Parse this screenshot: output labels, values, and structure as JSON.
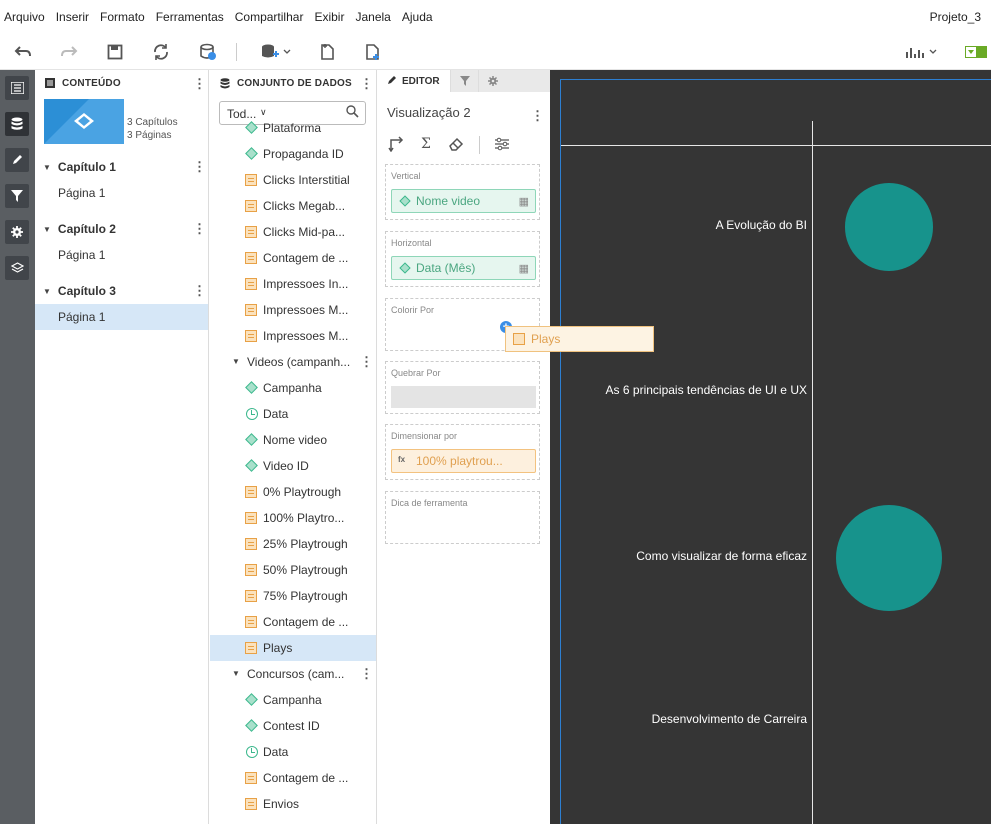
{
  "menu": {
    "items": [
      "Arquivo",
      "Inserir",
      "Formato",
      "Ferramentas",
      "Compartilhar",
      "Exibir",
      "Janela",
      "Ajuda"
    ],
    "project": "Projeto_3"
  },
  "toolbar": {
    "icons": [
      "undo-icon",
      "redo-icon",
      "save-icon",
      "refresh-icon",
      "datasource-icon",
      "add-data-icon",
      "duplicate-page-icon",
      "new-page-icon",
      "chart-type-icon",
      "layout-icon"
    ]
  },
  "content_panel": {
    "title": "CONTEÚDO",
    "chapters_count": "3 Capítulos",
    "pages_count": "3 Páginas",
    "chapters": [
      {
        "label": "Capítulo 1",
        "pages": [
          "Página 1"
        ]
      },
      {
        "label": "Capítulo 2",
        "pages": [
          "Página 1"
        ]
      },
      {
        "label": "Capítulo 3",
        "pages": [
          "Página 1"
        ]
      }
    ]
  },
  "dataset_panel": {
    "title": "CONJUNTO DE DADOS",
    "filter_value": "Tod...",
    "items": [
      {
        "type": "dim",
        "label": "Plataforma"
      },
      {
        "type": "dim",
        "label": "Propaganda ID"
      },
      {
        "type": "meas",
        "label": "Clicks Interstitial"
      },
      {
        "type": "meas",
        "label": "Clicks Megab..."
      },
      {
        "type": "meas",
        "label": "Clicks Mid-pa..."
      },
      {
        "type": "meas",
        "label": "Contagem de ..."
      },
      {
        "type": "meas",
        "label": "Impressoes In..."
      },
      {
        "type": "meas",
        "label": "Impressoes M..."
      },
      {
        "type": "meas",
        "label": "Impressoes M..."
      },
      {
        "type": "group",
        "label": "Videos (campanh..."
      },
      {
        "type": "dim",
        "label": "Campanha"
      },
      {
        "type": "time",
        "label": "Data"
      },
      {
        "type": "dim",
        "label": "Nome video"
      },
      {
        "type": "dim",
        "label": "Video ID"
      },
      {
        "type": "meas",
        "label": "0% Playtrough"
      },
      {
        "type": "meas",
        "label": "100% Playtro..."
      },
      {
        "type": "meas",
        "label": "25% Playtrough"
      },
      {
        "type": "meas",
        "label": "50% Playtrough"
      },
      {
        "type": "meas",
        "label": "75% Playtrough"
      },
      {
        "type": "meas",
        "label": "Contagem de ..."
      },
      {
        "type": "meas",
        "label": "Plays"
      },
      {
        "type": "group",
        "label": "Concursos (cam..."
      },
      {
        "type": "dim",
        "label": "Campanha"
      },
      {
        "type": "dim",
        "label": "Contest ID"
      },
      {
        "type": "time",
        "label": "Data"
      },
      {
        "type": "meas",
        "label": "Contagem de ..."
      },
      {
        "type": "meas",
        "label": "Envios"
      }
    ]
  },
  "editor": {
    "tab_label": "EDITOR",
    "viz_title": "Visualização 2",
    "shelves": {
      "vertical": {
        "label": "Vertical",
        "pill": "Nome video"
      },
      "horizontal": {
        "label": "Horizontal",
        "pill": "Data (Mês)"
      },
      "color": {
        "label": "Colorir Por"
      },
      "break": {
        "label": "Quebrar Por"
      },
      "size": {
        "label": "Dimensionar por",
        "pill": "100% playtrou..."
      },
      "tooltip": {
        "label": "Dica de ferramenta"
      }
    },
    "drag_item": "Plays"
  },
  "chart": {
    "bubble_color": "#17938c",
    "background": "#353535",
    "categories": [
      {
        "label": "A Evolução do BI",
        "size": 0.68
      },
      {
        "label": "As 6 principais tendências de UI e UX",
        "size": 0
      },
      {
        "label": "Como visualizar de forma eficaz",
        "size": 1.0
      },
      {
        "label": "Desenvolvimento de Carreira",
        "size": 0
      }
    ]
  }
}
